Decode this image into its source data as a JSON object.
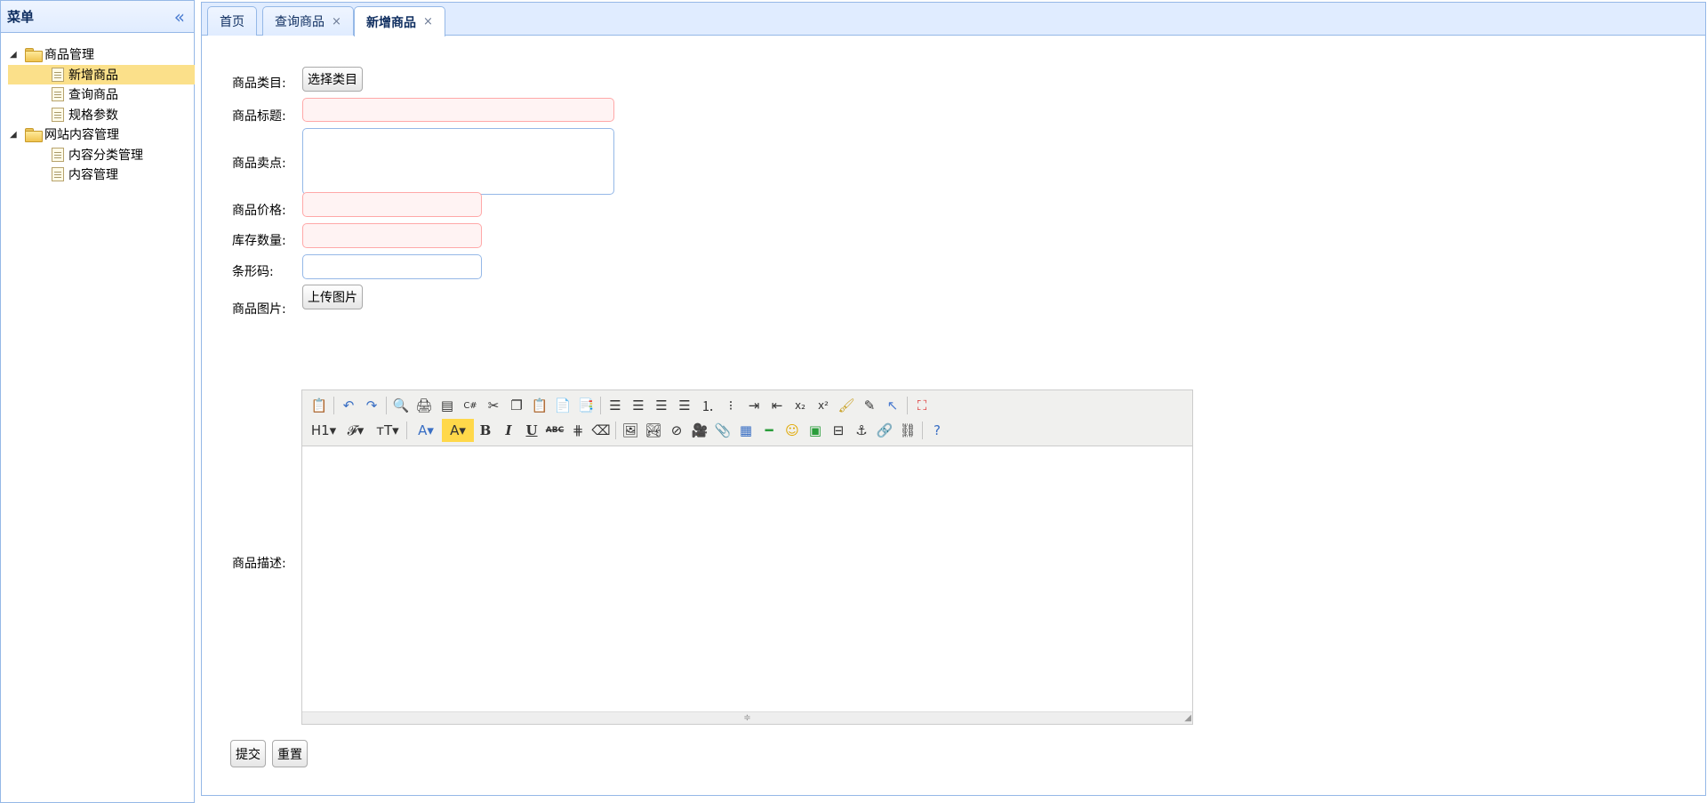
{
  "menu": {
    "title": "菜单",
    "tree": [
      {
        "label": "商品管理",
        "children": [
          "新增商品",
          "查询商品",
          "规格参数"
        ],
        "selected": "新增商品"
      },
      {
        "label": "网站内容管理",
        "children": [
          "内容分类管理",
          "内容管理"
        ]
      }
    ]
  },
  "tabs": [
    {
      "label": "首页"
    },
    {
      "label": "查询商品",
      "close": "×"
    },
    {
      "label": "新增商品",
      "close": "×"
    }
  ],
  "form": {
    "category_label": "商品类目:",
    "category_button": "选择类目",
    "title_label": "商品标题:",
    "sellpoint_label": "商品卖点:",
    "price_label": "商品价格:",
    "stock_label": "库存数量:",
    "barcode_label": "条形码:",
    "image_label": "商品图片:",
    "image_button": "上传图片",
    "desc_label": "商品描述:",
    "submit_button": "提交",
    "reset_button": "重置"
  },
  "editor": {
    "row1": [
      "source-icon",
      "|",
      "undo-icon",
      "redo-icon",
      "|",
      "preview-icon",
      "print-icon",
      "template-icon",
      "code-icon",
      "cut-icon",
      "copy-icon",
      "paste-icon",
      "paste-plain-icon",
      "paste-word-icon",
      "|",
      "align-left-icon",
      "align-center-icon",
      "align-right-icon",
      "align-justify-icon",
      "ordered-list-icon",
      "bullet-list-icon",
      "indent-icon",
      "outdent-icon",
      "subscript-icon",
      "superscript-icon",
      "clear-format-icon",
      "select-all-icon",
      "select-icon",
      "|",
      "fullscreen-icon"
    ],
    "row2": [
      "heading-icon",
      "font-family-icon",
      "font-size-icon",
      "|",
      "font-color-icon",
      "highlight-icon",
      "bold-icon",
      "italic-icon",
      "underline-icon",
      "strikethrough-icon",
      "line-height-icon",
      "eraser-icon",
      "|",
      "image-icon",
      "multi-image-icon",
      "flash-icon",
      "media-icon",
      "attach-icon",
      "table-icon",
      "hr-icon",
      "emoticon-icon",
      "map-icon",
      "pagebreak-icon",
      "anchor-icon",
      "link-icon",
      "unlink-icon",
      "|",
      "help-icon"
    ],
    "glyphs": {
      "heading": "H1▾",
      "font_family": "𝓕▾",
      "font_size": "тT▾",
      "font_color": "A▾",
      "highlight": "A▾",
      "bold": "B",
      "italic": "I",
      "underline": "U",
      "strike": "ABC",
      "sub": "x₂",
      "sup": "x²"
    },
    "status_glyph": "≑",
    "resize_glyph": "◢"
  }
}
